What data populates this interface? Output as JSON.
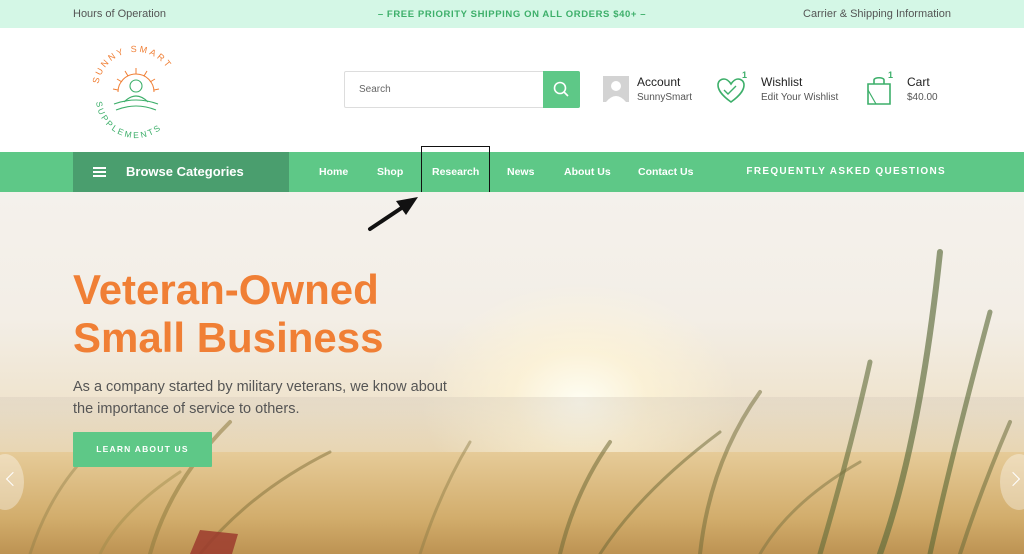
{
  "topbar": {
    "hours": "Hours of Operation",
    "promo": "– FREE PRIORITY SHIPPING ON ALL ORDERS $40+ –",
    "shipping_info": "Carrier & Shipping Information"
  },
  "logo": {
    "line1": "SUNNY SMART",
    "line2": "SUPPLEMENTS"
  },
  "search": {
    "placeholder": "Search",
    "value": ""
  },
  "account": {
    "title": "Account",
    "username": "SunnySmart",
    "icon": "user-avatar-icon"
  },
  "wishlist": {
    "title": "Wishlist",
    "subtitle": "Edit Your Wishlist",
    "count": "1",
    "icon": "heart-icon"
  },
  "cart": {
    "title": "Cart",
    "total": "$40.00",
    "count": "1",
    "icon": "shopping-bag-icon"
  },
  "nav": {
    "browse_label": "Browse Categories",
    "links": [
      "Home",
      "Shop",
      "Research",
      "News",
      "About Us",
      "Contact Us"
    ],
    "faq": "FREQUENTLY ASKED QUESTIONS"
  },
  "hero": {
    "title_line1": "Veteran-Owned",
    "title_line2": "Small Business",
    "subtitle": "As a company started by military veterans, we know about the importance of service to others.",
    "cta": "LEARN ABOUT US"
  },
  "colors": {
    "accent_green": "#5ec887",
    "dark_green": "#4a9e6e",
    "orange": "#f07f35",
    "topbar_bg": "#d4f7e6"
  }
}
